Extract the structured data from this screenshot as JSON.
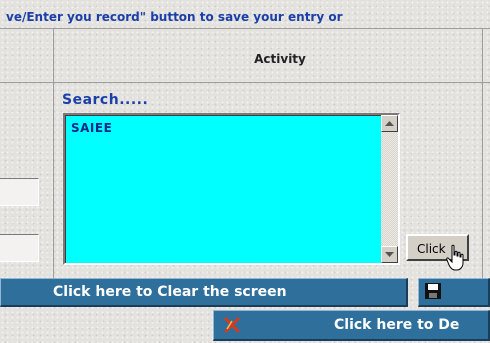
{
  "header": {
    "instruction": "ve/Enter you record\" button to save your entry or"
  },
  "table": {
    "activity_header": "Activity"
  },
  "search": {
    "label": "Search.....",
    "list_items": [
      "SAIEE"
    ]
  },
  "buttons": {
    "click_label": "Click",
    "clear_screen_label": "Click here to Clear the screen",
    "delete_label": "Click here to De"
  },
  "icons": {
    "save": "floppy-disk-icon",
    "delete": "red-x-icon",
    "cursor": "hand-pointer-icon",
    "scroll_up": "arrow-up-icon",
    "scroll_down": "arrow-down-icon"
  },
  "colors": {
    "accent_text": "#1b3fa8",
    "listbox_bg": "#00ffff",
    "bar_bg": "#2f6f9c"
  }
}
